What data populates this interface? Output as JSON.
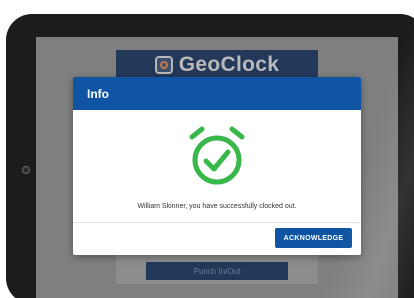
{
  "background_app": {
    "brand_name": "GeoClock",
    "punch_button_label": "Punch In/Out"
  },
  "dialog": {
    "title": "Info",
    "status_icon": "alarm-clock-check-icon",
    "message": "William Skinner, you have successfully clocked out.",
    "acknowledge_label": "ACKNOWLEDGE"
  },
  "colors": {
    "primary_blue": "#0e54a2",
    "success_green": "#38b84a",
    "overlay_gray": "#7f7f7f"
  }
}
